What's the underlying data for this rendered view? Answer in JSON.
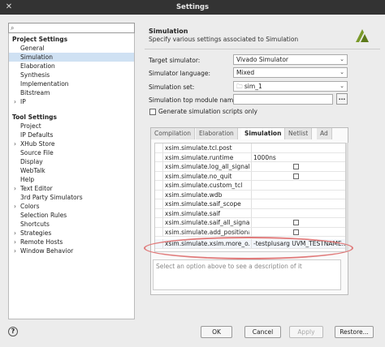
{
  "window": {
    "title": "Settings"
  },
  "sidebar": {
    "project_header": "Project Settings",
    "project_items": [
      "General",
      "Simulation",
      "Elaboration",
      "Synthesis",
      "Implementation",
      "Bitstream",
      "IP"
    ],
    "tool_header": "Tool Settings",
    "tool_items": [
      "Project",
      "IP Defaults",
      "XHub Store",
      "Source File",
      "Display",
      "WebTalk",
      "Help",
      "Text Editor",
      "3rd Party Simulators",
      "Colors",
      "Selection Rules",
      "Shortcuts",
      "Strategies",
      "Remote Hosts",
      "Window Behavior"
    ]
  },
  "section": {
    "title": "Simulation",
    "subtitle": "Specify various settings associated to Simulation"
  },
  "form": {
    "target_label": "Target simulator:",
    "target_value": "Vivado Simulator",
    "language_label": "Simulator language:",
    "language_value": "Mixed",
    "set_label": "Simulation set:",
    "set_value": "sim_1",
    "top_label": "Simulation top module name:",
    "top_value": "",
    "ellipsis": "...",
    "gen_scripts_label": "Generate simulation scripts only"
  },
  "tabs": [
    "Compilation",
    "Elaboration",
    "Simulation",
    "Netlist",
    "Ad"
  ],
  "table_rows": [
    {
      "name": "xsim.simulate.tcl.post",
      "value": ""
    },
    {
      "name": "xsim.simulate.runtime",
      "value": "1000ns"
    },
    {
      "name": "xsim.simulate.log_all_signals",
      "value": ""
    },
    {
      "name": "xsim.simulate.no_quit",
      "value": ""
    },
    {
      "name": "xsim.simulate.custom_tcl",
      "value": ""
    },
    {
      "name": "xsim.simulate.wdb",
      "value": ""
    },
    {
      "name": "xsim.simulate.saif_scope",
      "value": ""
    },
    {
      "name": "xsim.simulate.saif",
      "value": ""
    },
    {
      "name": "xsim.simulate.saif_all_signals",
      "value": ""
    },
    {
      "name": "xsim.simulate.add_positional",
      "value": ""
    },
    {
      "name": "xsim.simulate.xsim.more_o...",
      "value": "-testplusarg UVM_TESTNAME..."
    }
  ],
  "description_placeholder": "Select an option above to see a description of it",
  "buttons": {
    "help": "?",
    "ok": "OK",
    "cancel": "Cancel",
    "apply": "Apply",
    "restore": "Restore..."
  }
}
